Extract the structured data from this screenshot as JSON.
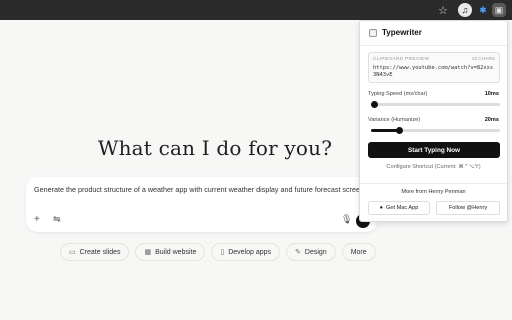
{
  "browser": {
    "star_icon": "☆",
    "extension_icons": [
      "music-note-icon",
      "puzzle-icon",
      "typewriter-icon"
    ]
  },
  "page": {
    "heading": "What can I do for you?",
    "prompt_text": "Generate the product structure of a weather app with current weather display and future forecast screen",
    "chips": [
      {
        "label": "Create slides",
        "icon": "slides-icon"
      },
      {
        "label": "Build website",
        "icon": "website-icon"
      },
      {
        "label": "Develop apps",
        "icon": "phone-icon"
      },
      {
        "label": "Design",
        "icon": "brush-icon"
      },
      {
        "label": "More",
        "icon": ""
      }
    ]
  },
  "popup": {
    "title": "Typewriter",
    "clipboard_label": "CLIPBOARD PREVIEW",
    "clipboard_count": "43 CHARS",
    "clipboard_text": "https://www.youtube.com/watch?v=82xxs3N43vE",
    "typing_speed_label": "Typing Speed (ms/char)",
    "typing_speed_value": "10ms",
    "typing_speed_fraction": 0.0,
    "variance_label": "Variance (Humanize)",
    "variance_value": "20ms",
    "variance_fraction": 0.22,
    "start_button": "Start Typing Now",
    "configure_shortcut": "Configure Shortcut (Current: ⌘⌃⌥Y)",
    "more_from": "More from Henry Penman",
    "get_mac_app": "Get Mac App",
    "follow": "Follow @Henry"
  },
  "colors": {
    "accent": "#111111",
    "page_bg": "#f7f7f6",
    "chrome_bg": "#2b2b2b"
  }
}
